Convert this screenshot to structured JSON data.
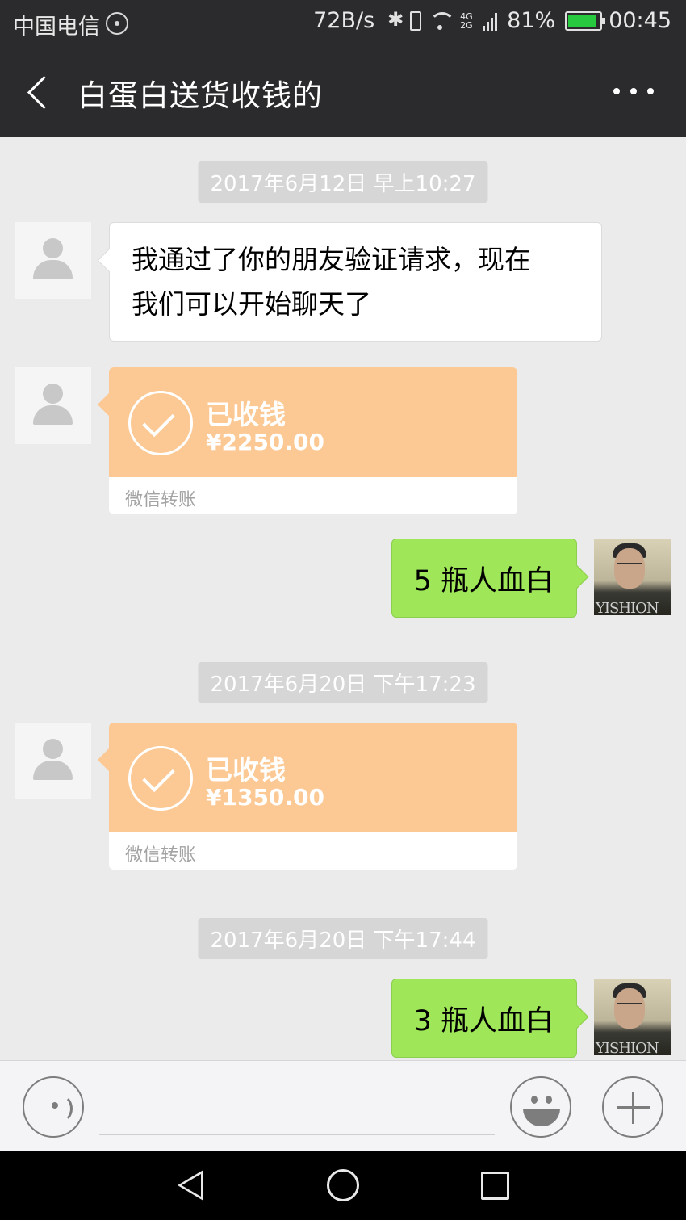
{
  "status_bar": {
    "carrier": "中国电信",
    "net_speed": "72B/s",
    "network_type_top": "4G",
    "network_type_bottom": "2G",
    "battery": "81%",
    "time": "00:45",
    "battery_color": "#27c93f"
  },
  "header": {
    "title": "白蛋白送货收钱的",
    "back_icon": "chevron-left-icon",
    "more_icon": "more-dots-icon"
  },
  "messages": [
    {
      "type": "timestamp",
      "text": "2017年6月12日 早上10:27"
    },
    {
      "type": "text",
      "from": "other",
      "text_line1": "我通过了你的朋友验证请求，现在",
      "text_line2": "我们可以开始聊天了"
    },
    {
      "type": "transfer",
      "from": "other",
      "status": "已收钱",
      "amount": "¥2250.00",
      "footer": "微信转账"
    },
    {
      "type": "text",
      "from": "self",
      "text": "5 瓶人血白"
    },
    {
      "type": "timestamp",
      "text": "2017年6月20日 下午17:23"
    },
    {
      "type": "transfer",
      "from": "other",
      "status": "已收钱",
      "amount": "¥1350.00",
      "footer": "微信转账"
    },
    {
      "type": "timestamp",
      "text": "2017年6月20日 下午17:44"
    },
    {
      "type": "text",
      "from": "self",
      "text": "3 瓶人血白"
    }
  ],
  "self_avatar_text": "YISHION",
  "colors": {
    "header_bg": "#2b2b2d",
    "chat_bg": "#ebebeb",
    "self_bubble": "#9fe658",
    "transfer_bubble": "#fcc994"
  },
  "input_bar": {
    "voice_icon": "voice-icon",
    "emoji_icon": "emoji-icon",
    "plus_icon": "plus-icon"
  },
  "system_nav": {
    "back": "triangle-back-icon",
    "home": "circle-home-icon",
    "recent": "square-recent-icon"
  }
}
